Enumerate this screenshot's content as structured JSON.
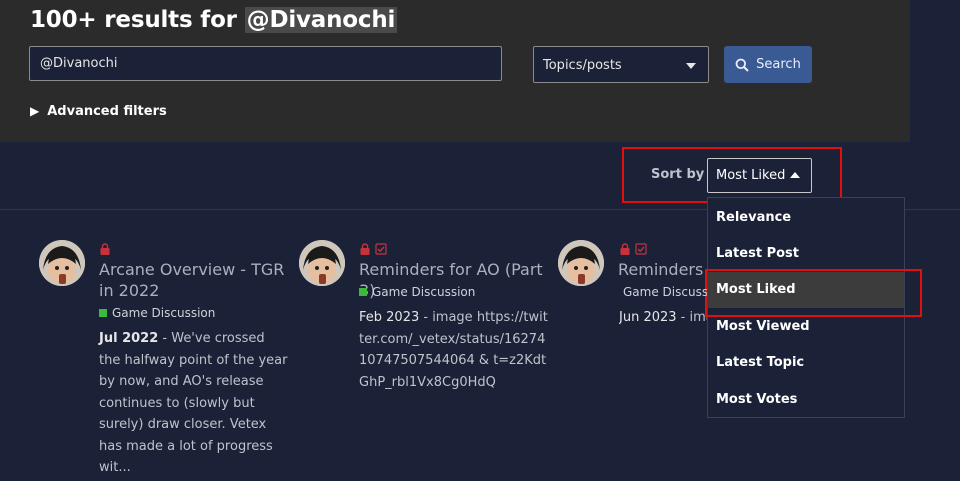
{
  "header": {
    "results_prefix": "100+ results for ",
    "results_query": "@Divanochi"
  },
  "search": {
    "input_value": "@Divanochi",
    "scope_value": "Topics/posts",
    "button_label": "Search"
  },
  "filters": {
    "advanced_label": "Advanced filters"
  },
  "sort": {
    "label": "Sort by",
    "selected": "Most Liked",
    "options": [
      "Relevance",
      "Latest Post",
      "Most Liked",
      "Most Viewed",
      "Latest Topic",
      "Most Votes"
    ]
  },
  "results": [
    {
      "title": "Arcane Overview - TGR in 2022",
      "category": "Game Discussion",
      "date": "Jul 2022",
      "excerpt": " - We've crossed the halfway point of the year by now, and AO's release continues to (slowly but surely) draw closer. Vetex has made a lot of progress wit..."
    },
    {
      "title": "Reminders for AO (Part 3)",
      "category": "Game Discussion",
      "date": "Feb 2023",
      "excerpt": " - image https://twitter.com/_vetex/status/1627410747507544064 & t=z2KdtGhP_rbl1Vx8Cg0HdQ"
    },
    {
      "title": "Reminders f",
      "category": "Game Discuss",
      "date": "Jun 2023",
      "excerpt": " - ima"
    }
  ],
  "colors": {
    "background": "#1b2237",
    "panel": "#2b2b2b",
    "accent_button": "#3a5a94",
    "category_green": "#3db83d",
    "lock_red": "#c8323c",
    "highlight_red": "#e01010"
  }
}
